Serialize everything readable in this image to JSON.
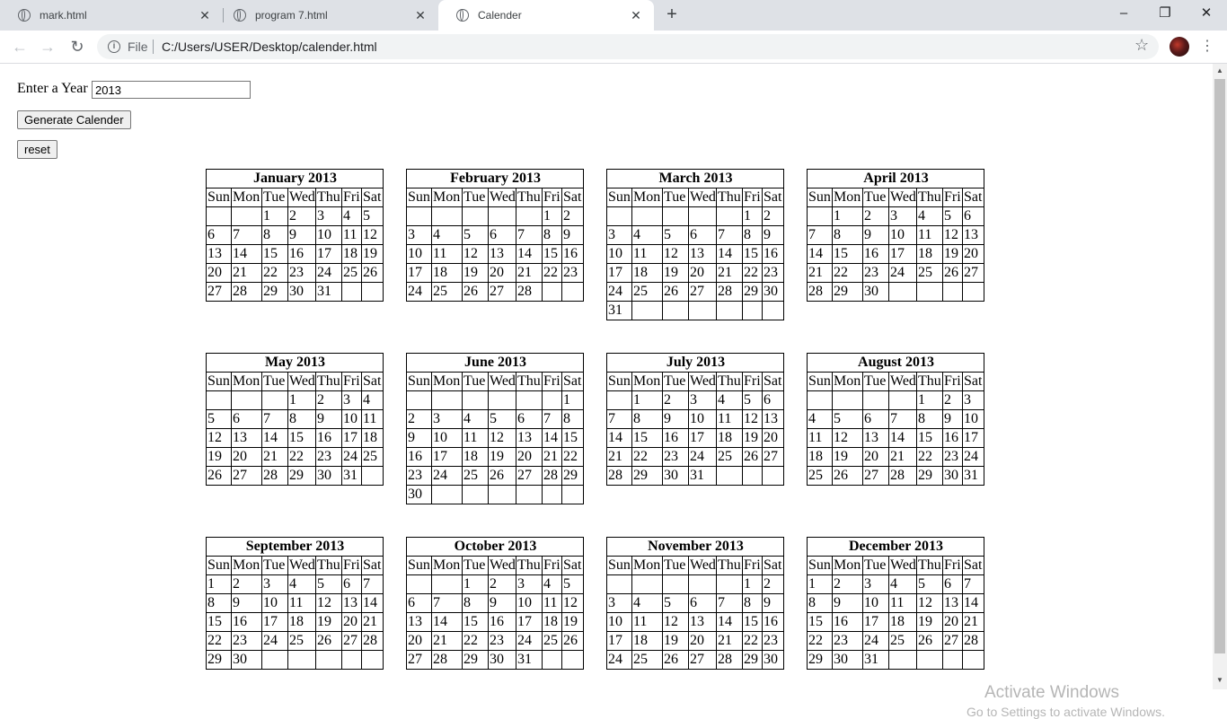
{
  "browser": {
    "tabs": [
      {
        "title": "mark.html"
      },
      {
        "title": "program 7.html"
      },
      {
        "title": "Calender"
      }
    ],
    "address": {
      "scheme": "File",
      "url": "C:/Users/USER/Desktop/calender.html"
    }
  },
  "page": {
    "year_label": "Enter a Year",
    "year_value": "2013",
    "generate_label": "Generate Calender",
    "reset_label": "reset",
    "weekdays": [
      "Sun",
      "Mon",
      "Tue",
      "Wed",
      "Thu",
      "Fri",
      "Sat"
    ],
    "months": [
      {
        "title": "January 2013",
        "start": 2,
        "days": 31
      },
      {
        "title": "February 2013",
        "start": 5,
        "days": 28
      },
      {
        "title": "March 2013",
        "start": 5,
        "days": 31
      },
      {
        "title": "April 2013",
        "start": 1,
        "days": 30
      },
      {
        "title": "May 2013",
        "start": 3,
        "days": 31
      },
      {
        "title": "June 2013",
        "start": 6,
        "days": 30
      },
      {
        "title": "July 2013",
        "start": 1,
        "days": 31
      },
      {
        "title": "August 2013",
        "start": 4,
        "days": 31
      },
      {
        "title": "September 2013",
        "start": 0,
        "days": 30
      },
      {
        "title": "October 2013",
        "start": 2,
        "days": 31
      },
      {
        "title": "November 2013",
        "start": 5,
        "days": 30
      },
      {
        "title": "December 2013",
        "start": 0,
        "days": 31
      }
    ]
  },
  "os": {
    "watermark_title": "Activate Windows",
    "watermark_text": "Go to Settings to activate Windows."
  }
}
